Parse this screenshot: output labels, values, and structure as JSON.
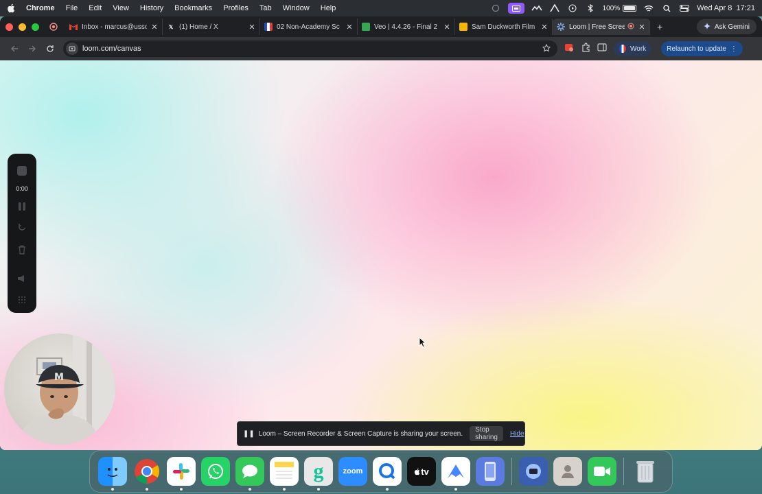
{
  "menubar": {
    "items": [
      "Chrome",
      "File",
      "Edit",
      "View",
      "History",
      "Bookmarks",
      "Profiles",
      "Tab",
      "Window",
      "Help"
    ],
    "battery": "100%",
    "battery_level": 1.0,
    "datetime": "Wed Apr 8  17:21"
  },
  "tabs": [
    {
      "title": "Inbox - marcus@usso",
      "favicon": "gmail-icon",
      "active": false
    },
    {
      "title": "(1) Home / X",
      "favicon": "x-icon",
      "active": false
    },
    {
      "title": "02 Non-Academy Sc",
      "favicon": "flag-icon",
      "active": false
    },
    {
      "title": "Veo | 4.4.26 - Final 2",
      "favicon": "sheets-icon",
      "active": false
    },
    {
      "title": "Sam Duckworth Film",
      "favicon": "slides-icon",
      "active": false
    },
    {
      "title": "Loom | Free Scree",
      "favicon": "loom-icon",
      "active": true
    }
  ],
  "gemini_label": "Ask Gemini",
  "address": "loom.com/canvas",
  "profile_label": "Work",
  "relaunch_label": "Relaunch to update",
  "loom": {
    "timer": "0:00"
  },
  "share_banner": {
    "message": "Loom – Screen Recorder & Screen Capture is sharing your screen.",
    "stop_label": "Stop sharing",
    "hide_label": "Hide"
  },
  "colors": {
    "accent": "#8b5cf6",
    "relaunch": "#1c4a8a",
    "loom_blue": "#625df5"
  },
  "dock": [
    "finder",
    "chrome",
    "slack",
    "whatsapp",
    "messages",
    "notes",
    "grammarly",
    "zoom",
    "quickshare",
    "apple-tv",
    "nordvpn",
    "simulator",
    "screenium",
    "contacts",
    "facetime",
    "trash"
  ],
  "dock_labels": {
    "zoom": "zoom",
    "tv": "tv",
    "grammarly": "g"
  }
}
